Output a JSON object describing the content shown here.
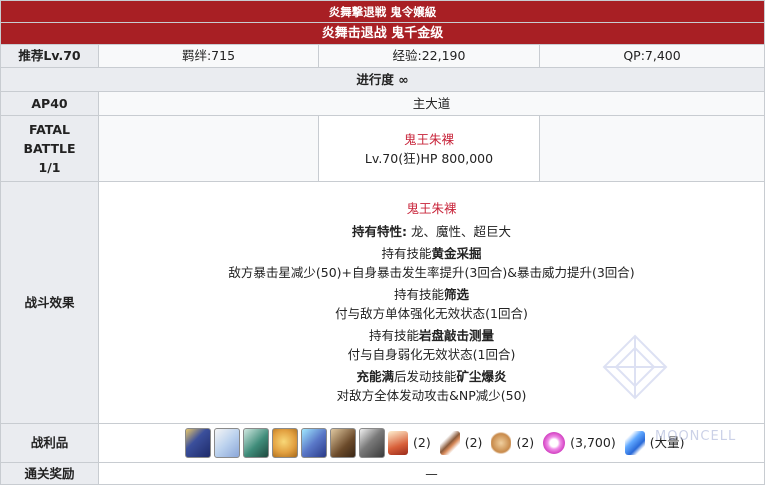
{
  "header": {
    "title_jp": "炎舞撃退戦 鬼令嬢級",
    "title_cn": "炎舞击退战 鬼千金级"
  },
  "stats": {
    "rec_level": "推荐Lv.70",
    "bond": "羁绊:715",
    "exp": "经验:22,190",
    "qp": "QP:7,400"
  },
  "progress": "进行度 ∞",
  "ap": {
    "label": "AP40",
    "location": "主大道"
  },
  "fatal": {
    "label_line1": "FATAL",
    "label_line2": "BATTLE",
    "label_line3": "1/1",
    "enemy_name": "鬼王朱裸",
    "enemy_stats": "Lv.70(狂)HP 800,000"
  },
  "effects": {
    "label": "战斗效果",
    "enemy_name": "鬼王朱裸",
    "traits_prefix": "持有特性:",
    "traits_value": " 龙、魔性、超巨大",
    "skill1_prefix": "持有技能",
    "skill1_name": "黄金采掘",
    "skill1_desc": "敌方暴击星减少(50)+自身暴击发生率提升(3回合)&暴击威力提升(3回合)",
    "skill2_prefix": "持有技能",
    "skill2_name": "筛选",
    "skill2_desc": "付与敌方单体强化无效状态(1回合)",
    "skill3_prefix": "持有技能",
    "skill3_name": "岩盘敲击测量",
    "skill3_desc": "付与自身弱化无效状态(1回合)",
    "np_prefix1": "充能满",
    "np_prefix2": "后发动技能",
    "np_name": "矿尘爆炎",
    "np_desc": "对敌方全体发动攻击&NP减少(50)"
  },
  "drops": {
    "label": "战利品",
    "counts": [
      "(2)",
      "(2)",
      "(2)",
      "(3,700)",
      "(大量)"
    ],
    "colors": {
      "card1": "#3b4f9c",
      "card2": "#bcd2ee",
      "card3": "#3f8c7a",
      "card4": "#e2a040",
      "card5": "#5a78c8",
      "card6": "#6b4a2a",
      "card7": "#3a3a3a",
      "item1": "#d8603a",
      "item2": "#8a5a3a",
      "item3": "#c88a4a",
      "item4": "#d84cc8",
      "item5": "#2a6ad8"
    }
  },
  "reward": {
    "label": "通关奖励",
    "value": "—"
  },
  "watermark": {
    "text": "MOONCELL"
  }
}
